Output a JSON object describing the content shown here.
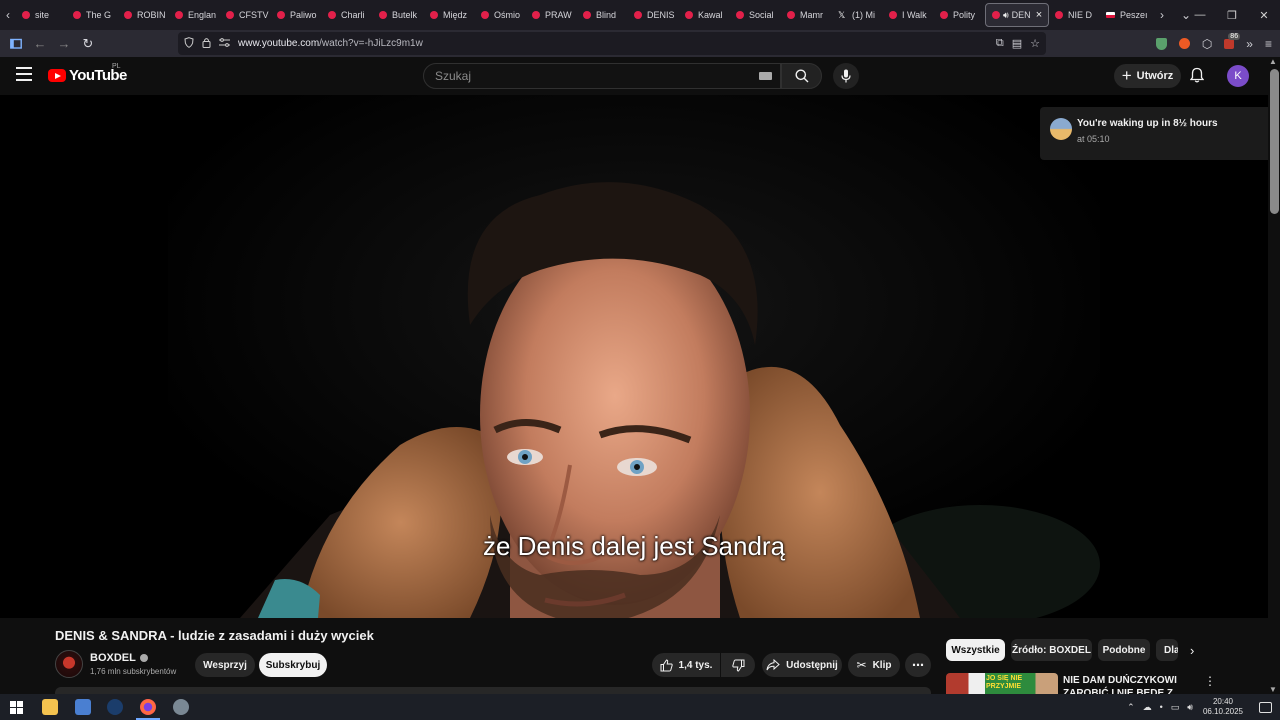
{
  "browser": {
    "tabs": [
      {
        "label": "site",
        "icon": "youtube-favicon"
      },
      {
        "label": "The G",
        "icon": "youtube-favicon"
      },
      {
        "label": "ROBIN",
        "icon": "youtube-favicon"
      },
      {
        "label": "Englan",
        "icon": "youtube-favicon"
      },
      {
        "label": "CFSTV",
        "icon": "youtube-favicon"
      },
      {
        "label": "Paliwo",
        "icon": "youtube-favicon"
      },
      {
        "label": "Charli",
        "icon": "youtube-favicon"
      },
      {
        "label": "Butelk",
        "icon": "youtube-favicon"
      },
      {
        "label": "Międz",
        "icon": "youtube-favicon"
      },
      {
        "label": "Ośmio",
        "icon": "youtube-favicon"
      },
      {
        "label": "PRAW",
        "icon": "youtube-favicon"
      },
      {
        "label": "Blind",
        "icon": "youtube-favicon"
      },
      {
        "label": "DENIS",
        "icon": "youtube-favicon"
      },
      {
        "label": "Kawal",
        "icon": "youtube-favicon"
      },
      {
        "label": "Social",
        "icon": "youtube-favicon"
      },
      {
        "label": "Mamr",
        "icon": "youtube-favicon"
      },
      {
        "label": "(1) Mi",
        "icon": "x-favicon"
      },
      {
        "label": "I Walk",
        "icon": "youtube-favicon"
      },
      {
        "label": "Polity",
        "icon": "youtube-favicon"
      }
    ],
    "active_tab": {
      "label": "DEN",
      "close": "×"
    },
    "trailing_tabs": [
      {
        "label": "NIE D",
        "icon": "youtube-favicon"
      },
      {
        "label": "Peszeı",
        "icon": "polish-flag-favicon"
      }
    ],
    "url_host": "www.youtube.com",
    "url_path": "/watch?v=-hJiLzc9m1w",
    "extension_badge": "86"
  },
  "youtube": {
    "logo_text": "YouTube",
    "region": "PL",
    "search_placeholder": "Szukaj",
    "create_label": "Utwórz",
    "avatar_letter": "K"
  },
  "notification": {
    "title": "You're waking up in 8½ hours",
    "subtitle": "at 05:10",
    "close": "x"
  },
  "player": {
    "subtitle": "że Denis dalej jest Sandrą"
  },
  "video": {
    "title": "DENIS & SANDRA - ludzie z zasadami i duży wyciek",
    "channel_name": "BOXDEL",
    "subscribers": "1,76 mln subskrybentów",
    "support_label": "Wesprzyj",
    "subscribe_label": "Subskrybuj",
    "likes": "1,4 tys.",
    "share_label": "Udostępnij",
    "clip_label": "Klip",
    "more_label": "⋯"
  },
  "related": {
    "chips": [
      "Wszystkie",
      "Źródło: BOXDEL",
      "Podobne",
      "Dla"
    ],
    "first_title": "NIE DAM DUŃCZYKOWI ZAROBIĆ I NIE BĘDĘ Z TEGO",
    "first_thumb_text": "JO SIĘ NIE PRZYJMIE"
  },
  "taskbar": {
    "time": "20:40",
    "date": "06.10.2025"
  }
}
